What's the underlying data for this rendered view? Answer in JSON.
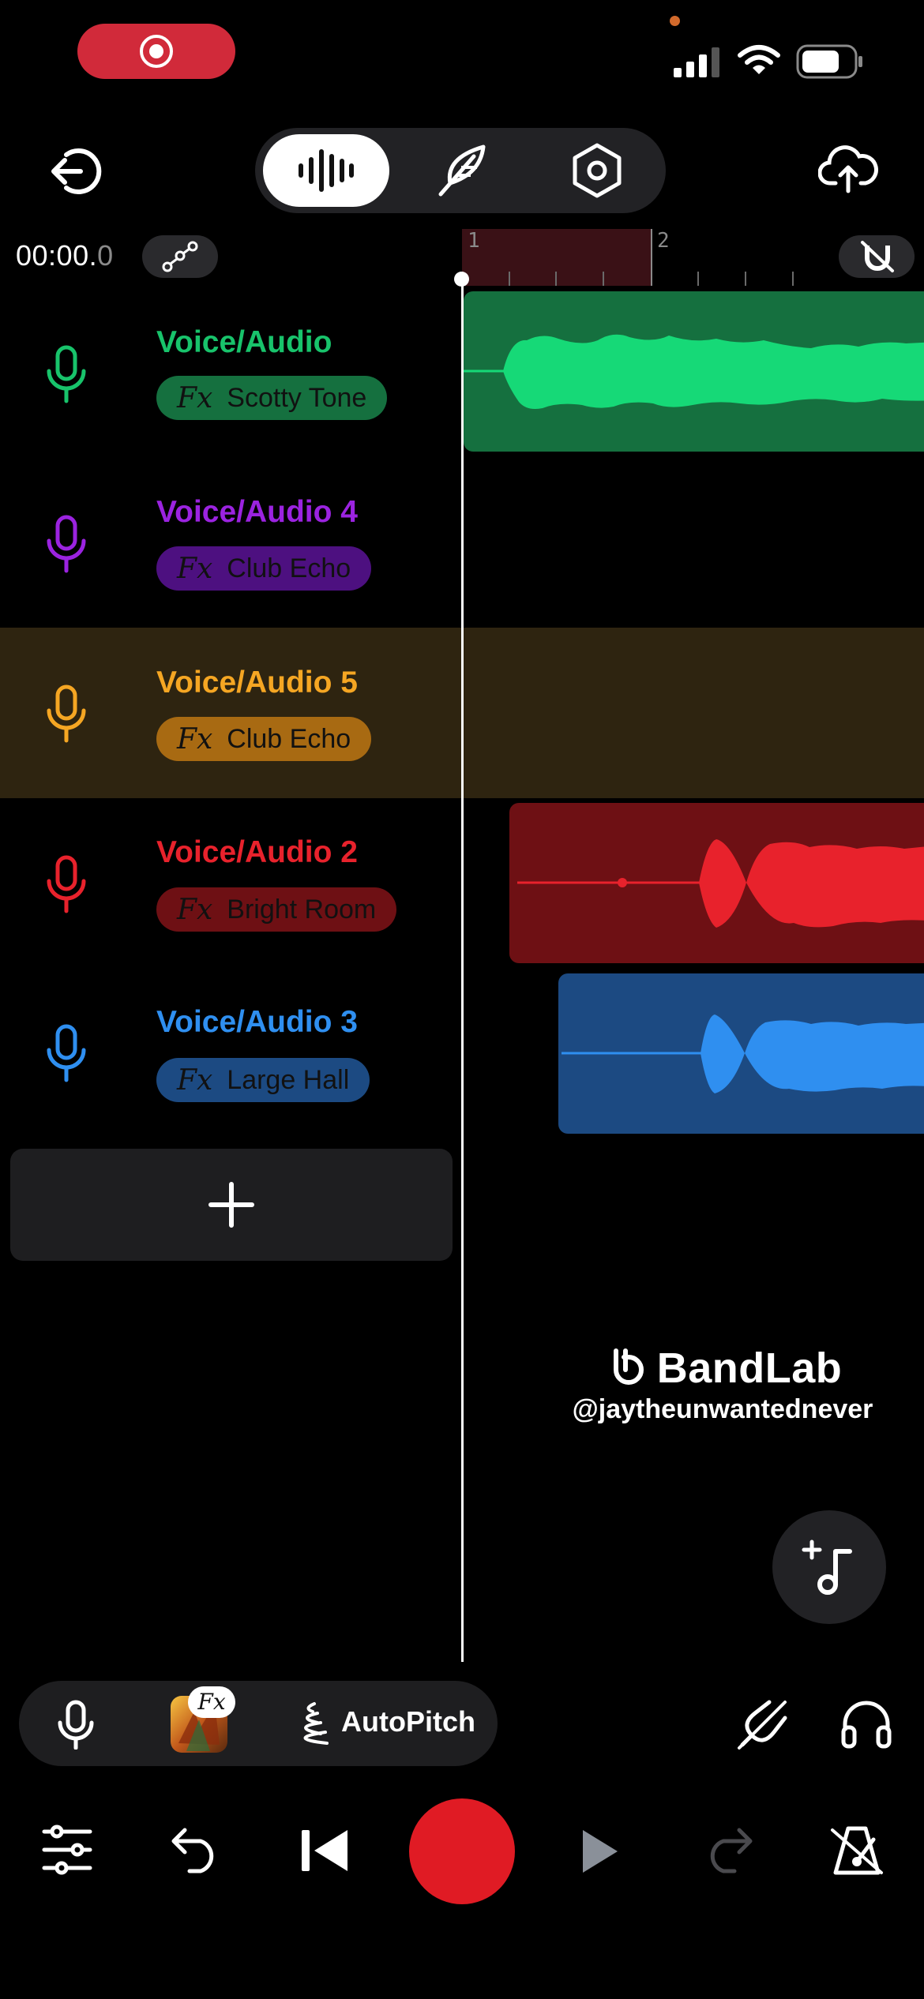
{
  "timeline": {
    "timecode_main": "00:00.",
    "timecode_fraction": "0",
    "ruler_marks": [
      "1",
      "2"
    ]
  },
  "tracks": [
    {
      "name": "Voice/Audio",
      "effect": "Scotty Tone",
      "color": "#18c36b",
      "fx_bg": "#15703f",
      "fx_text": "#111111"
    },
    {
      "name": "Voice/Audio 4",
      "effect": "Club Echo",
      "color": "#9b23e0",
      "fx_bg": "#4d1080",
      "fx_text": "#111111"
    },
    {
      "name": "Voice/Audio 5",
      "effect": "Club Echo",
      "color": "#f5a623",
      "fx_bg": "#a86a12",
      "fx_text": "#111111"
    },
    {
      "name": "Voice/Audio 2",
      "effect": "Bright Room",
      "color": "#e8222c",
      "fx_bg": "#6e1014",
      "fx_text": "#111111"
    },
    {
      "name": "Voice/Audio 3",
      "effect": "Large Hall",
      "color": "#2f8ff0",
      "fx_bg": "#1c4a82",
      "fx_text": "#111111"
    }
  ],
  "fx_label": "Fx",
  "selected_track_index": 2,
  "watermark": {
    "brand": "BandLab",
    "username": "@jaytheunwantednever"
  },
  "bottom_tools": {
    "fx_badge": "Fx",
    "autopitch_label": "AutoPitch"
  },
  "colors": {
    "record": "#e01b24",
    "status_pill": "#d12a3a",
    "selected_row_bg": "#2e2410"
  },
  "icons": {
    "status": [
      "record-icon",
      "signal-icon",
      "wifi-icon",
      "battery-icon"
    ],
    "toolbar": [
      "exit-icon",
      "waveform-icon",
      "feather-icon",
      "settings-hex-icon",
      "cloud-upload-icon"
    ],
    "transport": [
      "mixer-icon",
      "undo-icon",
      "skip-back-icon",
      "record-icon",
      "play-icon",
      "redo-icon",
      "metronome-icon"
    ]
  }
}
